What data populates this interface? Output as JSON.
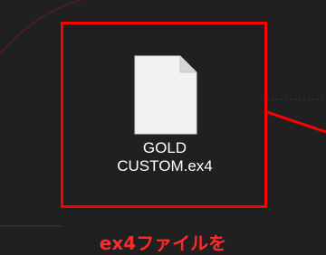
{
  "file": {
    "name_line1": "GOLD",
    "name_line2": "CUSTOM.ex4",
    "icon": "document-icon"
  },
  "caption": "ex4ファイルを",
  "colors": {
    "background": "#202020",
    "highlight": "#ff0000",
    "caption": "#ff2a2a",
    "file_icon": "#f2f2f2"
  }
}
